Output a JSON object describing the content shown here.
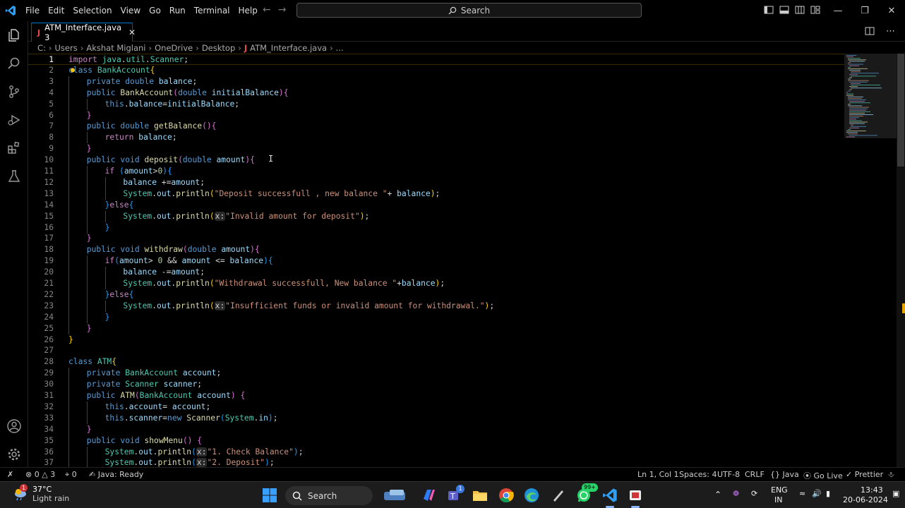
{
  "titlebar": {
    "menus": [
      "File",
      "Edit",
      "Selection",
      "View",
      "Go",
      "Run",
      "Terminal",
      "Help"
    ],
    "search_label": "Search"
  },
  "tab": {
    "title": "ATM_Interface.java 3",
    "icon_letter": "J"
  },
  "breadcrumb": [
    "C:",
    "Users",
    "Akshat Miglani",
    "OneDrive",
    "Desktop",
    "ATM_Interface.java",
    "..."
  ],
  "code_lines": [
    {
      "n": "1",
      "indent": 0,
      "html": "<span class='kw'>import</span> <span class='ty'>java</span>.<span class='ty'>util</span>.<span class='ty'>Scanner</span>;"
    },
    {
      "n": "2",
      "indent": 0,
      "html": "<span class='kw2'>class</span> <span class='ty'>BankAccount</span><span class='br1'>{</span>"
    },
    {
      "n": "3",
      "indent": 1,
      "html": "<span class='kw2'>private</span> <span class='kw2'>double</span> <span class='var'>balance</span>;"
    },
    {
      "n": "4",
      "indent": 1,
      "html": "<span class='kw2'>public</span> <span class='fn'>BankAccount</span><span class='br2'>(</span><span class='kw2'>double</span> <span class='var'>initialBalance</span><span class='br2'>)</span><span class='br2'>{</span>"
    },
    {
      "n": "5",
      "indent": 2,
      "html": "<span class='kw2'>this</span>.<span class='var'>balance</span>=<span class='var'>initialBalance</span>;"
    },
    {
      "n": "6",
      "indent": 1,
      "html": "<span class='br2'>}</span>"
    },
    {
      "n": "7",
      "indent": 1,
      "html": "<span class='kw2'>public</span> <span class='kw2'>double</span> <span class='fn'>getBalance</span><span class='br2'>()</span><span class='br2'>{</span>"
    },
    {
      "n": "8",
      "indent": 2,
      "html": "<span class='kw'>return</span> <span class='var'>balance</span>;"
    },
    {
      "n": "9",
      "indent": 1,
      "html": "<span class='br2'>}</span>"
    },
    {
      "n": "10",
      "indent": 1,
      "html": "<span class='kw2'>public</span> <span class='kw2'>void</span> <span class='fn'>deposit</span><span class='br2'>(</span><span class='kw2'>double</span> <span class='var'>amount</span><span class='br2'>)</span><span class='br2'>{</span>"
    },
    {
      "n": "11",
      "indent": 2,
      "html": "<span class='kw'>if</span> <span class='br3'>(</span><span class='var'>amount</span>&gt;<span class='num'>0</span><span class='br3'>)</span><span class='br3'>{</span>"
    },
    {
      "n": "12",
      "indent": 3,
      "html": "<span class='var'>balance</span> +=<span class='var'>amount</span>;"
    },
    {
      "n": "13",
      "indent": 3,
      "html": "<span class='ty'>System</span>.<span class='var'>out</span>.<span class='fn'>println</span><span class='br1'>(</span><span class='str'>\"Deposit successfull , new balance \"</span>+ <span class='var'>balance</span><span class='br1'>)</span>;"
    },
    {
      "n": "14",
      "indent": 2,
      "html": "<span class='br3'>}</span><span class='kw'>else</span><span class='br3'>{</span>"
    },
    {
      "n": "15",
      "indent": 3,
      "html": "<span class='ty'>System</span>.<span class='var'>out</span>.<span class='fn'>println</span><span class='br1'>(</span><span class='hint'>x:</span><span class='str'>\"Invalid amount for deposit\"</span><span class='br1'>)</span>;"
    },
    {
      "n": "16",
      "indent": 2,
      "html": "<span class='br3'>}</span>"
    },
    {
      "n": "17",
      "indent": 1,
      "html": "<span class='br2'>}</span>"
    },
    {
      "n": "18",
      "indent": 1,
      "html": "<span class='kw2'>public</span> <span class='kw2'>void</span> <span class='fn'>withdraw</span><span class='br2'>(</span><span class='kw2'>double</span> <span class='var'>amount</span><span class='br2'>)</span><span class='br2'>{</span>"
    },
    {
      "n": "19",
      "indent": 2,
      "html": "<span class='kw'>if</span><span class='br3'>(</span><span class='var'>amount</span>&gt; <span class='num'>0</span> &amp;&amp; <span class='var'>amount</span> &lt;= <span class='var'>balance</span><span class='br3'>)</span><span class='br3'>{</span>"
    },
    {
      "n": "20",
      "indent": 3,
      "html": "<span class='var'>balance</span> -=<span class='var'>amount</span>;"
    },
    {
      "n": "21",
      "indent": 3,
      "html": "<span class='ty'>System</span>.<span class='var'>out</span>.<span class='fn'>println</span><span class='br1'>(</span><span class='str'>\"Withdrawal successfull, New balance \"</span>+<span class='var'>balance</span><span class='br1'>)</span>;"
    },
    {
      "n": "22",
      "indent": 2,
      "html": "<span class='br3'>}</span><span class='kw'>else</span><span class='br3'>{</span>"
    },
    {
      "n": "23",
      "indent": 3,
      "html": "<span class='ty'>System</span>.<span class='var'>out</span>.<span class='fn'>println</span><span class='br1'>(</span><span class='hint'>x:</span><span class='str'>\"Insufficient funds or invalid amount for withdrawal.\"</span><span class='br1'>)</span>;"
    },
    {
      "n": "24",
      "indent": 2,
      "html": "<span class='br3'>}</span>"
    },
    {
      "n": "25",
      "indent": 1,
      "html": "<span class='br2'>}</span>"
    },
    {
      "n": "26",
      "indent": 0,
      "html": "<span class='br1'>}</span>"
    },
    {
      "n": "27",
      "indent": 0,
      "html": ""
    },
    {
      "n": "28",
      "indent": 0,
      "html": "<span class='kw2'>class</span> <span class='ty'>ATM</span><span class='br1'>{</span>"
    },
    {
      "n": "29",
      "indent": 1,
      "html": "<span class='kw2'>private</span> <span class='ty'>BankAccount</span> <span class='var'>account</span>;"
    },
    {
      "n": "30",
      "indent": 1,
      "html": "<span class='kw2'>private</span> <span class='ty'>Scanner</span> <span class='var'>scanner</span>;"
    },
    {
      "n": "31",
      "indent": 1,
      "html": "<span class='kw2'>public</span> <span class='fn'>ATM</span><span class='br2'>(</span><span class='ty'>BankAccount</span> <span class='var'>account</span><span class='br2'>)</span> <span class='br2'>{</span>"
    },
    {
      "n": "32",
      "indent": 2,
      "html": "<span class='kw2'>this</span>.<span class='var'>account</span>= <span class='var'>account</span>;"
    },
    {
      "n": "33",
      "indent": 2,
      "html": "<span class='kw2'>this</span>.<span class='var'>scanner</span>=<span class='kw2'>new</span> <span class='fn'>Scanner</span><span class='br3'>(</span><span class='ty'>System</span>.<span class='var'>in</span><span class='br3'>)</span>;"
    },
    {
      "n": "34",
      "indent": 1,
      "html": "<span class='br2'>}</span>"
    },
    {
      "n": "35",
      "indent": 1,
      "html": "<span class='kw2'>public</span> <span class='kw2'>void</span> <span class='fn'>showMenu</span><span class='br2'>()</span> <span class='br2'>{</span>"
    },
    {
      "n": "36",
      "indent": 2,
      "html": "<span class='ty'>System</span>.<span class='var'>out</span>.<span class='fn'>println</span><span class='br3'>(</span><span class='hint'>x:</span><span class='str'>\"1. Check Balance\"</span><span class='br3'>)</span>;"
    },
    {
      "n": "37",
      "indent": 2,
      "html": "<span class='ty'>System</span>.<span class='var'>out</span>.<span class='fn'>println</span><span class='br3'>(</span><span class='hint'>x:</span><span class='str'>\"2. Deposit\"</span><span class='br3'>)</span>;"
    }
  ],
  "statusbar": {
    "errors": "0",
    "warnings": "3",
    "ports": "0",
    "java_status": "Java: Ready",
    "position": "Ln 1, Col 1",
    "spaces": "Spaces: 4",
    "encoding": "UTF-8",
    "eol": "CRLF",
    "language": "Java",
    "go_live": "Go Live",
    "prettier": "Prettier"
  },
  "taskbar": {
    "weather_temp": "37°C",
    "weather_desc": "Light rain",
    "search_label": "Search",
    "teams_badge": "1",
    "whatsapp_badge": "99+",
    "lang_top": "ENG",
    "lang_bottom": "IN",
    "time": "13:43",
    "date": "20-06-2024"
  },
  "colors": {
    "accent": "#0078d4",
    "background": "#000000",
    "keyword": "#569cd6",
    "control": "#c586c0",
    "type": "#4ec9b0",
    "function": "#dcdcaa",
    "string": "#ce9178"
  }
}
